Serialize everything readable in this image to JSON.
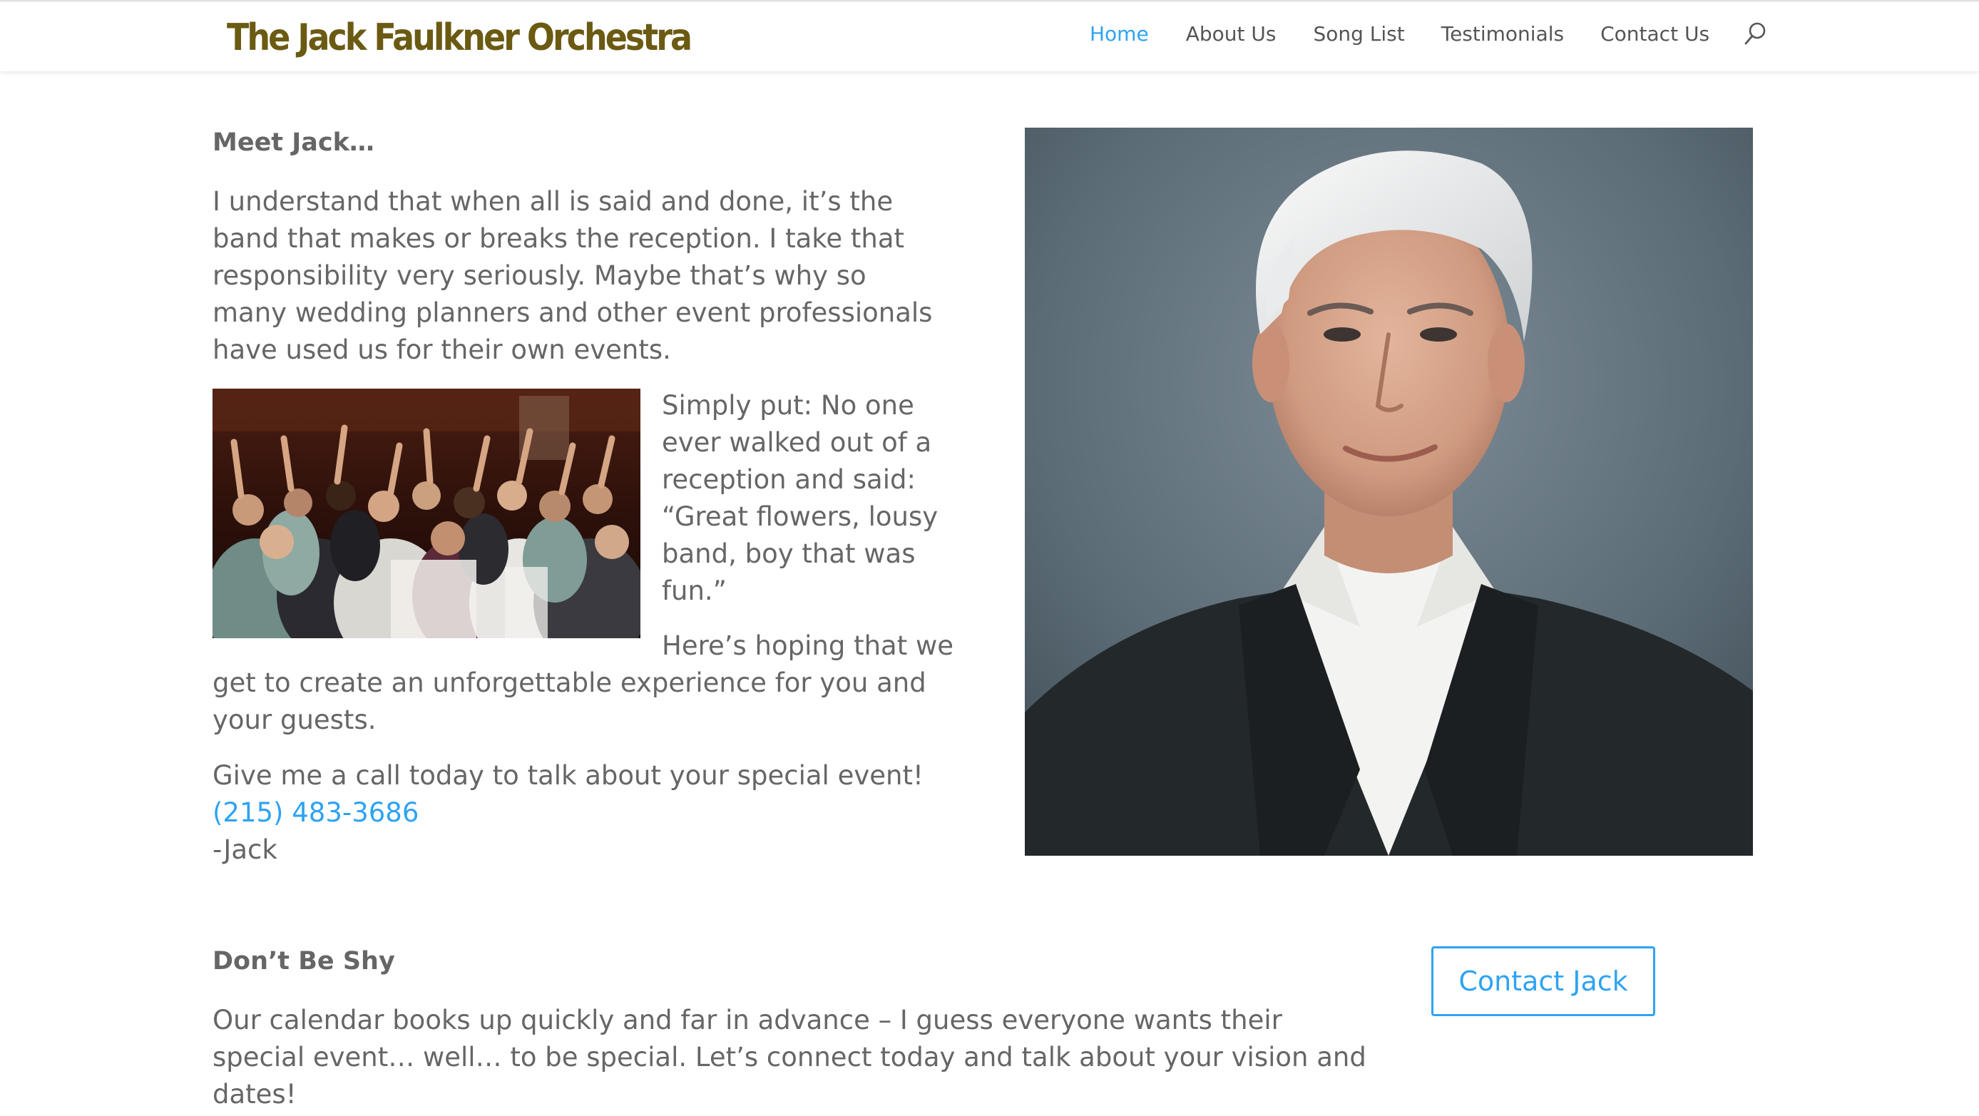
{
  "site": {
    "logo_text": "The Jack Faulkner Orchestra"
  },
  "nav": {
    "items": [
      {
        "label": "Home",
        "active": true
      },
      {
        "label": "About Us",
        "active": false
      },
      {
        "label": "Song List",
        "active": false
      },
      {
        "label": "Testimonials",
        "active": false
      },
      {
        "label": "Contact Us",
        "active": false
      }
    ],
    "search_icon": "search-icon"
  },
  "meet": {
    "heading": "Meet Jack…",
    "intro": "I understand that when all is said and done, it’s the band that makes or breaks the reception. I take that responsibility very seriously. Maybe that’s why so many wedding planners and other event professionals have used us for their own events.",
    "simply_put": "Simply put: No one ever walked out of a reception and said: “Great flowers, lousy band, boy that was fun.”",
    "hoping_line1": "Here’s hoping that we",
    "hoping_line2": "get to create an unforgettable experience for you and your guests.",
    "call_text": "Give me a call today to talk about your special event!",
    "phone": "(215) 483-3686",
    "signature": "-Jack"
  },
  "shy": {
    "heading": "Don’t Be Shy",
    "text": "Our calendar books up quickly and far in advance – I guess everyone wants their special event… well… to be special. Let’s connect today and talk about your vision and dates!",
    "button_label": "Contact Jack"
  },
  "colors": {
    "accent": "#2ea3f2",
    "logo": "#6b5a12",
    "body_text": "#666666"
  }
}
